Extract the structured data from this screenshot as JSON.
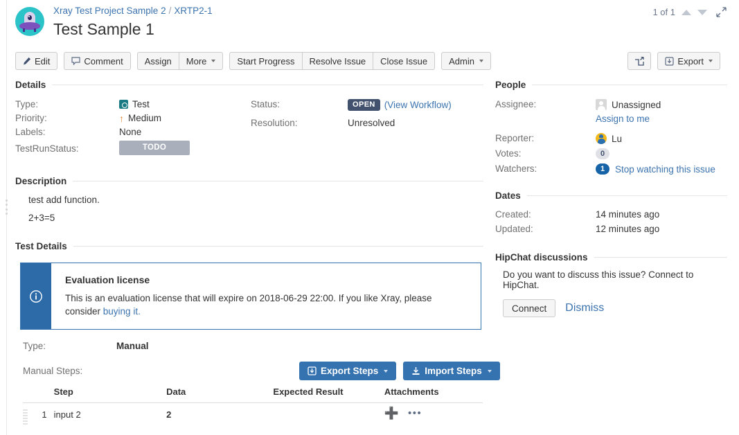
{
  "header": {
    "breadcrumb_project": "Xray Test Project Sample 2",
    "breadcrumb_separator": "/",
    "breadcrumb_key": "XRTP2-1",
    "issue_title": "Test Sample 1",
    "pager_count": "1 of 1"
  },
  "toolbar": {
    "edit": "Edit",
    "comment": "Comment",
    "assign": "Assign",
    "more": "More",
    "start_progress": "Start Progress",
    "resolve_issue": "Resolve Issue",
    "close_issue": "Close Issue",
    "admin": "Admin",
    "export": "Export"
  },
  "details": {
    "heading": "Details",
    "labels": {
      "type": "Type:",
      "priority": "Priority:",
      "labels": "Labels:",
      "testrunstatus": "TestRunStatus:",
      "status": "Status:",
      "resolution": "Resolution:"
    },
    "values": {
      "type": "Test",
      "priority": "Medium",
      "labels": "None",
      "testrunstatus": "TODO",
      "status": "OPEN",
      "status_link": "(View Workflow)",
      "resolution": "Unresolved"
    }
  },
  "description": {
    "heading": "Description",
    "line1": "test add function.",
    "line2": "2+3=5"
  },
  "test_details": {
    "heading": "Test Details",
    "banner": {
      "title": "Evaluation license",
      "text": "This is an evaluation license that will expire on 2018-06-29 22:00. If you like Xray, please consider ",
      "link": "buying it."
    },
    "type_label": "Type:",
    "type_value": "Manual",
    "manual_steps_label": "Manual Steps:",
    "export_steps": "Export Steps",
    "import_steps": "Import Steps",
    "table": {
      "columns": [
        "Step",
        "Data",
        "Expected Result",
        "Attachments"
      ],
      "rows": [
        {
          "num": "1",
          "step": "input 2",
          "data": "2",
          "expected": "",
          "attachments": ""
        }
      ]
    }
  },
  "people": {
    "heading": "People",
    "labels": {
      "assignee": "Assignee:",
      "reporter": "Reporter:",
      "votes": "Votes:",
      "watchers": "Watchers:"
    },
    "values": {
      "assignee": "Unassigned",
      "assign_to_me": "Assign to me",
      "reporter": "Lu",
      "votes": "0",
      "watchers_count": "1",
      "watchers_link": "Stop watching this issue"
    }
  },
  "dates": {
    "heading": "Dates",
    "labels": {
      "created": "Created:",
      "updated": "Updated:"
    },
    "values": {
      "created": "14 minutes ago",
      "updated": "12 minutes ago"
    }
  },
  "hipchat": {
    "heading": "HipChat discussions",
    "prompt": "Do you want to discuss this issue? Connect to HipChat.",
    "connect": "Connect",
    "dismiss": "Dismiss"
  },
  "colors": {
    "link": "#3b73af",
    "primary_button": "#3572b0",
    "status_open": "#42526e",
    "todo_badge": "#a9b0bb",
    "brand_teal": "#2bc3c8"
  }
}
